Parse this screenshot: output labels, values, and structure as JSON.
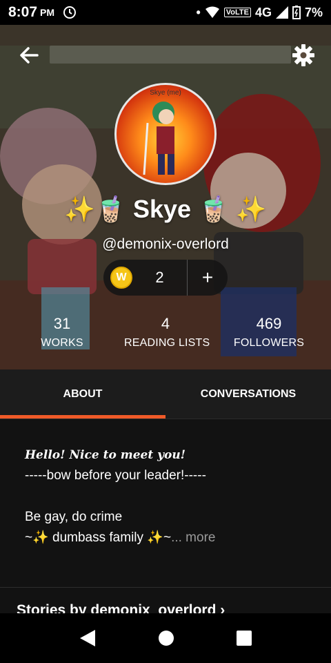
{
  "status_bar": {
    "time": "8:07",
    "ampm": "PM",
    "network": "4G",
    "volte": "VoLTE",
    "battery": "7%"
  },
  "avatar": {
    "label": "Skye (me)"
  },
  "profile": {
    "name": "✨🧋 Skye 🧋 ✨",
    "handle": "@demonix-overlord"
  },
  "coins": {
    "count": "2",
    "plus": "+",
    "icon_letter": "W"
  },
  "stats": [
    {
      "value": "31",
      "label": "WORKS"
    },
    {
      "value": "4",
      "label": "READING LISTS"
    },
    {
      "value": "469",
      "label": "FOLLOWERS"
    }
  ],
  "tabs": [
    {
      "label": "ABOUT",
      "active": true
    },
    {
      "label": "CONVERSATIONS",
      "active": false
    }
  ],
  "about": {
    "greeting": "Hello! Nice to meet you!",
    "line1": "-----bow before your leader!-----",
    "line2": "Be gay, do crime",
    "line3": "~✨ dumbass family ✨~",
    "more": "... more"
  },
  "stories_heading": "Stories by demonix_overlord ›",
  "colors": {
    "accent": "#f05a28",
    "background": "#121212",
    "coin": "#f5c518"
  },
  "icons": [
    "arrow-left-icon",
    "gear-icon",
    "wattpad-coin-icon",
    "plus-icon",
    "nav-back-icon",
    "nav-home-icon",
    "nav-recents-icon"
  ]
}
